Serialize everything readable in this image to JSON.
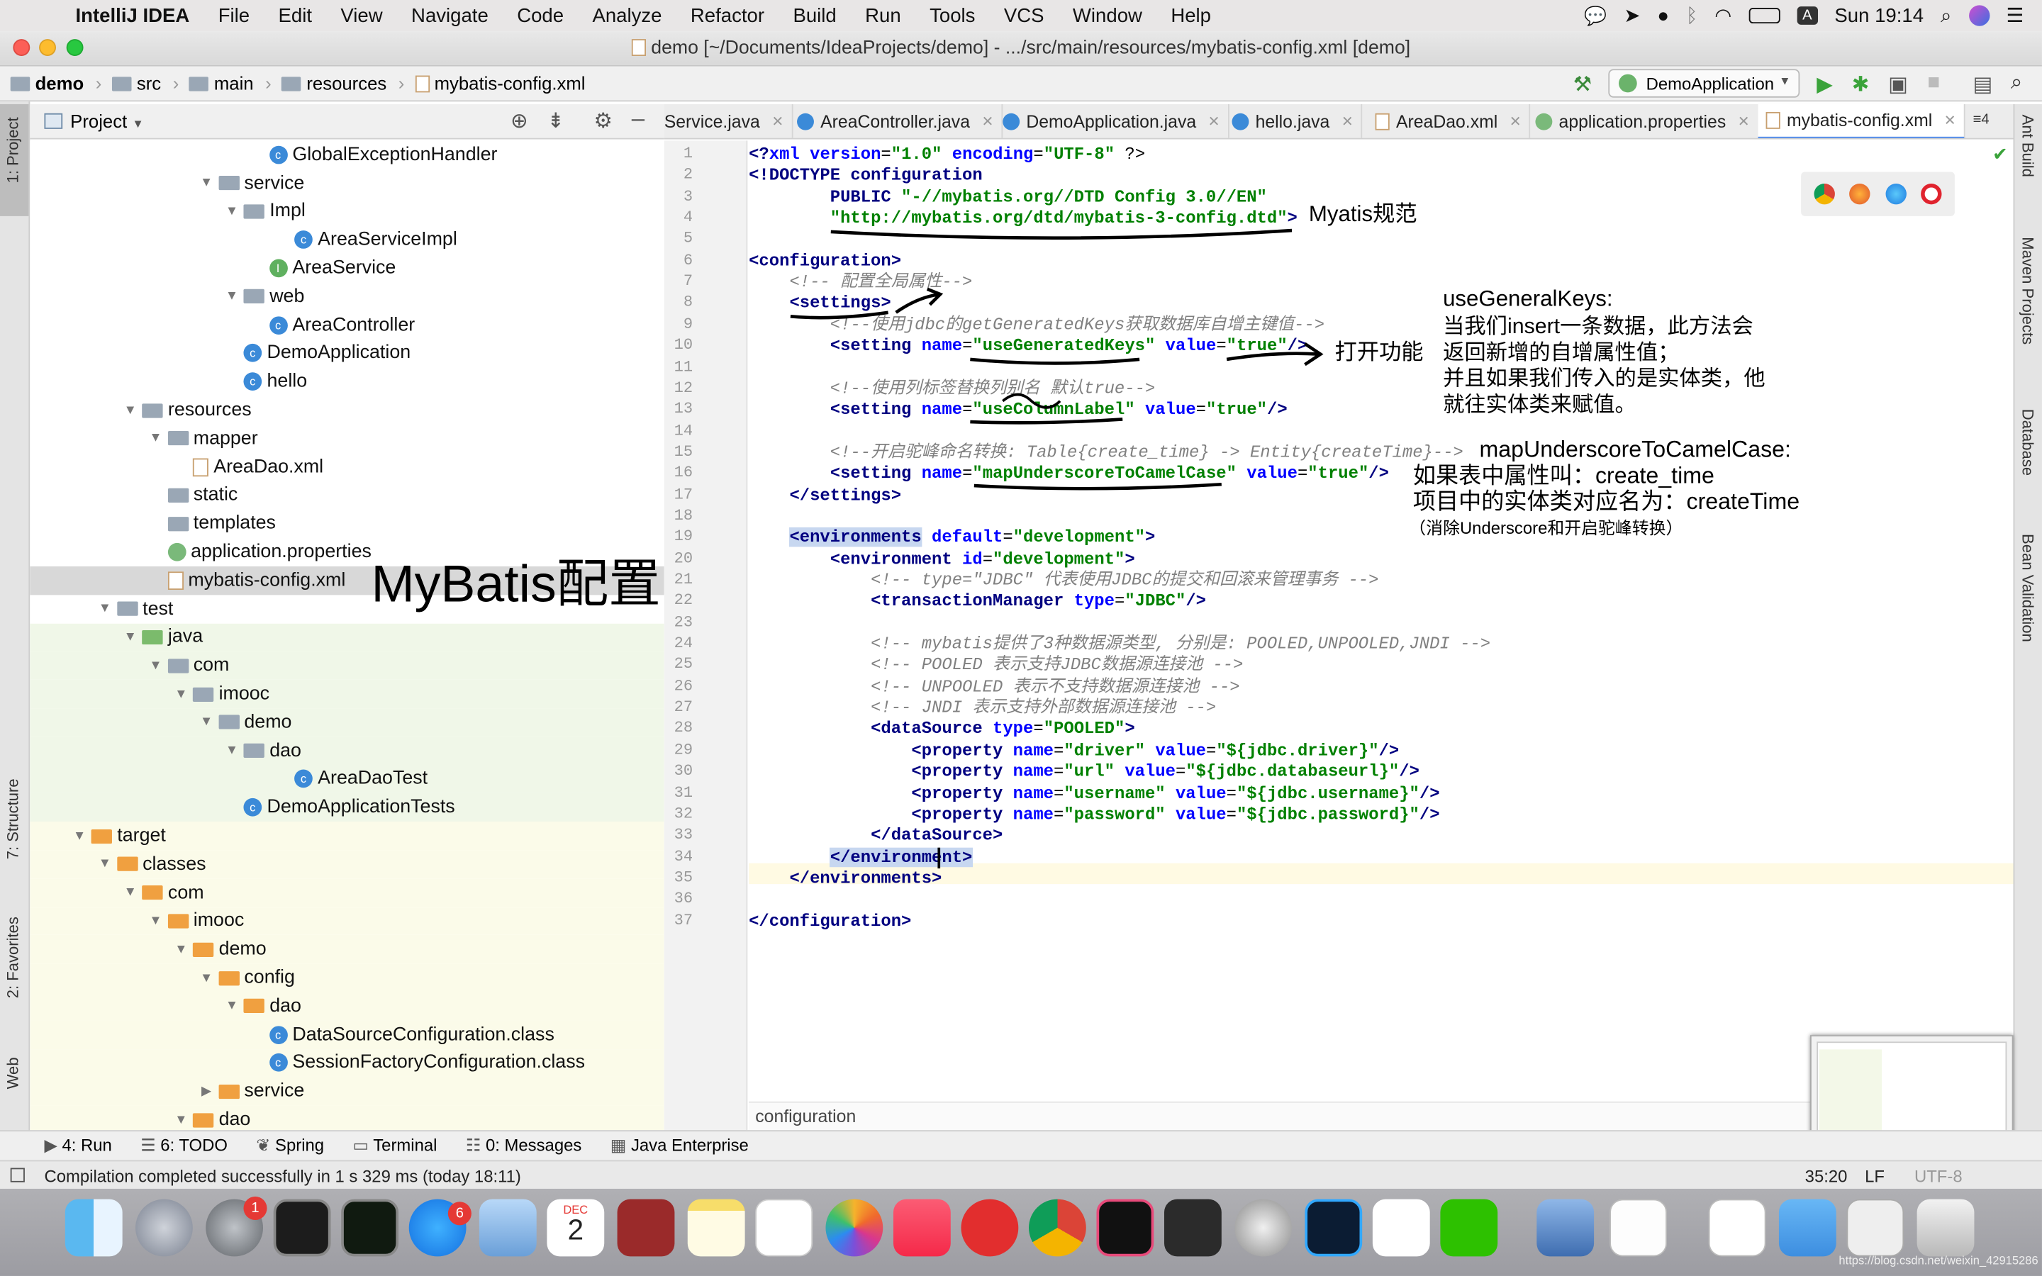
{
  "menubar": {
    "app_name": "IntelliJ IDEA",
    "items": [
      "File",
      "Edit",
      "View",
      "Navigate",
      "Code",
      "Analyze",
      "Refactor",
      "Build",
      "Run",
      "Tools",
      "VCS",
      "Window",
      "Help"
    ],
    "clock": "Sun 19:14",
    "input_indicator": "A"
  },
  "window": {
    "title": "demo [~/Documents/IdeaProjects/demo] - .../src/main/resources/mybatis-config.xml [demo]"
  },
  "breadcrumb": [
    "demo",
    "src",
    "main",
    "resources",
    "mybatis-config.xml"
  ],
  "run_config": "DemoApplication",
  "project_panel": {
    "title": "Project",
    "rows": [
      {
        "label": "GlobalExceptionHandler",
        "icon": "class-icon",
        "depth": 9,
        "arrow": ""
      },
      {
        "label": "service",
        "icon": "folder-icon",
        "depth": 7,
        "arrow": "▼"
      },
      {
        "label": "Impl",
        "icon": "folder-icon",
        "depth": 8,
        "arrow": "▼"
      },
      {
        "label": "AreaServiceImpl",
        "icon": "class-icon",
        "depth": 10,
        "arrow": ""
      },
      {
        "label": "AreaService",
        "icon": "interface-icon",
        "depth": 9,
        "arrow": ""
      },
      {
        "label": "web",
        "icon": "folder-icon",
        "depth": 8,
        "arrow": "▼"
      },
      {
        "label": "AreaController",
        "icon": "class-icon",
        "depth": 9,
        "arrow": ""
      },
      {
        "label": "DemoApplication",
        "icon": "spring-class-icon",
        "depth": 8,
        "arrow": ""
      },
      {
        "label": "hello",
        "icon": "class-icon",
        "depth": 8,
        "arrow": ""
      },
      {
        "label": "resources",
        "icon": "resources-folder-icon",
        "depth": 4,
        "arrow": "▼"
      },
      {
        "label": "mapper",
        "icon": "folder-icon",
        "depth": 5,
        "arrow": "▼"
      },
      {
        "label": "AreaDao.xml",
        "icon": "xml-file-icon",
        "depth": 6,
        "arrow": ""
      },
      {
        "label": "static",
        "icon": "folder-icon",
        "depth": 5,
        "arrow": ""
      },
      {
        "label": "templates",
        "icon": "folder-icon",
        "depth": 5,
        "arrow": ""
      },
      {
        "label": "application.properties",
        "icon": "properties-file-icon",
        "depth": 5,
        "arrow": ""
      },
      {
        "label": "mybatis-config.xml",
        "icon": "xml-file-icon",
        "depth": 5,
        "arrow": "",
        "selected": true
      },
      {
        "label": "test",
        "icon": "folder-icon",
        "depth": 3,
        "arrow": "▼"
      },
      {
        "label": "java",
        "icon": "test-folder-icon",
        "depth": 4,
        "arrow": "▼",
        "bg": "test"
      },
      {
        "label": "com",
        "icon": "folder-icon",
        "depth": 5,
        "arrow": "▼",
        "bg": "test"
      },
      {
        "label": "imooc",
        "icon": "folder-icon",
        "depth": 6,
        "arrow": "▼",
        "bg": "test"
      },
      {
        "label": "demo",
        "icon": "folder-icon",
        "depth": 7,
        "arrow": "▼",
        "bg": "test"
      },
      {
        "label": "dao",
        "icon": "folder-icon",
        "depth": 8,
        "arrow": "▼",
        "bg": "test"
      },
      {
        "label": "AreaDaoTest",
        "icon": "test-class-icon",
        "depth": 10,
        "arrow": "",
        "bg": "test"
      },
      {
        "label": "DemoApplicationTests",
        "icon": "test-class-icon",
        "depth": 8,
        "arrow": "",
        "bg": "test"
      },
      {
        "label": "target",
        "icon": "orange-folder-icon",
        "depth": 2,
        "arrow": "▼",
        "bg": "target"
      },
      {
        "label": "classes",
        "icon": "orange-folder-icon",
        "depth": 3,
        "arrow": "▼",
        "bg": "target"
      },
      {
        "label": "com",
        "icon": "orange-folder-icon",
        "depth": 4,
        "arrow": "▼",
        "bg": "target"
      },
      {
        "label": "imooc",
        "icon": "orange-folder-icon",
        "depth": 5,
        "arrow": "▼",
        "bg": "target"
      },
      {
        "label": "demo",
        "icon": "orange-folder-icon",
        "depth": 6,
        "arrow": "▼",
        "bg": "target"
      },
      {
        "label": "config",
        "icon": "orange-folder-icon",
        "depth": 7,
        "arrow": "▼",
        "bg": "target"
      },
      {
        "label": "dao",
        "icon": "orange-folder-icon",
        "depth": 8,
        "arrow": "▼",
        "bg": "target"
      },
      {
        "label": "DataSourceConfiguration.class",
        "icon": "class-icon",
        "depth": 9,
        "arrow": "",
        "bg": "target"
      },
      {
        "label": "SessionFactoryConfiguration.class",
        "icon": "class-icon",
        "depth": 9,
        "arrow": "",
        "bg": "target"
      },
      {
        "label": "service",
        "icon": "orange-folder-icon",
        "depth": 7,
        "arrow": "▶",
        "bg": "target"
      },
      {
        "label": "dao",
        "icon": "orange-folder-icon",
        "depth": 6,
        "arrow": "▼",
        "bg": "target"
      }
    ]
  },
  "tabs": [
    {
      "label": "Service.java",
      "active": false
    },
    {
      "label": "AreaController.java",
      "active": false
    },
    {
      "label": "DemoApplication.java",
      "active": false
    },
    {
      "label": "hello.java",
      "active": false
    },
    {
      "label": "AreaDao.xml",
      "active": false
    },
    {
      "label": "application.properties",
      "active": false
    },
    {
      "label": "mybatis-config.xml",
      "active": true
    }
  ],
  "tab_overflow": "≡4",
  "left_stripe": [
    "1: Project",
    "7: Structure",
    "2: Favorites",
    "Web"
  ],
  "right_stripe": [
    "Ant Build",
    "Maven Projects",
    "Database",
    "Bean Validation"
  ],
  "editor": {
    "lines": [
      [
        [
          "tag",
          "<?"
        ],
        [
          "attr",
          "xml "
        ],
        [
          "attr",
          "version"
        ],
        [
          "",
          "="
        ],
        [
          "str",
          "\"1.0\""
        ],
        [
          "attr",
          " encoding"
        ],
        [
          "",
          "="
        ],
        [
          "str",
          "\"UTF-8\""
        ],
        [
          "",
          " ?>"
        ]
      ],
      [
        [
          "tag",
          "<!DOCTYPE "
        ],
        [
          "tag",
          "configuration"
        ]
      ],
      [
        [
          "",
          "        "
        ],
        [
          "tag",
          "PUBLIC "
        ],
        [
          "str",
          "\"-//mybatis.org//DTD Config 3.0//EN\""
        ]
      ],
      [
        [
          "",
          "        "
        ],
        [
          "str",
          "\"http://mybatis.org/dtd/mybatis-3-config.dtd\""
        ],
        [
          "tag",
          ">"
        ]
      ],
      [
        [
          "",
          ""
        ]
      ],
      [
        [
          "tag",
          "<configuration>"
        ]
      ],
      [
        [
          "",
          "    "
        ],
        [
          "cmt",
          "<!-- 配置全局属性-->"
        ]
      ],
      [
        [
          "",
          "    "
        ],
        [
          "tag",
          "<settings>"
        ]
      ],
      [
        [
          "",
          "        "
        ],
        [
          "cmt",
          "<!--使用jdbc的getGeneratedKeys获取数据库自增主键值-->"
        ]
      ],
      [
        [
          "",
          "        "
        ],
        [
          "tag",
          "<setting "
        ],
        [
          "attr",
          "name"
        ],
        [
          "",
          "="
        ],
        [
          "str",
          "\"useGeneratedKeys\""
        ],
        [
          "attr",
          " value"
        ],
        [
          "",
          "="
        ],
        [
          "str",
          "\"true\""
        ],
        [
          "tag",
          "/>"
        ]
      ],
      [
        [
          "",
          ""
        ]
      ],
      [
        [
          "",
          "        "
        ],
        [
          "cmt",
          "<!--使用列标签替换列别名 默认true-->"
        ]
      ],
      [
        [
          "",
          "        "
        ],
        [
          "tag",
          "<setting "
        ],
        [
          "attr",
          "name"
        ],
        [
          "",
          "="
        ],
        [
          "str",
          "\"useColumnLabel\""
        ],
        [
          "attr",
          " value"
        ],
        [
          "",
          "="
        ],
        [
          "str",
          "\"true\""
        ],
        [
          "tag",
          "/>"
        ]
      ],
      [
        [
          "",
          ""
        ]
      ],
      [
        [
          "",
          "        "
        ],
        [
          "cmt",
          "<!--开启驼峰命名转换: Table{create_time} -> Entity{createTime}-->"
        ]
      ],
      [
        [
          "",
          "        "
        ],
        [
          "tag",
          "<setting "
        ],
        [
          "attr",
          "name"
        ],
        [
          "",
          "="
        ],
        [
          "str",
          "\"mapUnderscoreToCamelCase\""
        ],
        [
          "attr",
          " value"
        ],
        [
          "",
          "="
        ],
        [
          "str",
          "\"true\""
        ],
        [
          "tag",
          "/>"
        ]
      ],
      [
        [
          "",
          "    "
        ],
        [
          "tag",
          "</settings>"
        ]
      ],
      [
        [
          "",
          ""
        ]
      ],
      [
        [
          "",
          "    "
        ],
        [
          "tag",
          "<environments"
        ],
        [
          "attr",
          " default"
        ],
        [
          "",
          "="
        ],
        [
          "str",
          "\"development\""
        ],
        [
          "tag",
          ">"
        ]
      ],
      [
        [
          "",
          "        "
        ],
        [
          "tag",
          "<environment "
        ],
        [
          "attr",
          "id"
        ],
        [
          "",
          "="
        ],
        [
          "str",
          "\"development\""
        ],
        [
          "tag",
          ">"
        ]
      ],
      [
        [
          "",
          "            "
        ],
        [
          "cmt",
          "<!-- type=\"JDBC\" 代表使用JDBC的提交和回滚来管理事务 -->"
        ]
      ],
      [
        [
          "",
          "            "
        ],
        [
          "tag",
          "<transactionManager "
        ],
        [
          "attr",
          "type"
        ],
        [
          "",
          "="
        ],
        [
          "str",
          "\"JDBC\""
        ],
        [
          "tag",
          "/>"
        ]
      ],
      [
        [
          "",
          ""
        ]
      ],
      [
        [
          "",
          "            "
        ],
        [
          "cmt",
          "<!-- mybatis提供了3种数据源类型, 分别是: POOLED,UNPOOLED,JNDI -->"
        ]
      ],
      [
        [
          "",
          "            "
        ],
        [
          "cmt",
          "<!-- POOLED 表示支持JDBC数据源连接池 -->"
        ]
      ],
      [
        [
          "",
          "            "
        ],
        [
          "cmt",
          "<!-- UNPOOLED 表示不支持数据源连接池 -->"
        ]
      ],
      [
        [
          "",
          "            "
        ],
        [
          "cmt",
          "<!-- JNDI 表示支持外部数据源连接池 -->"
        ]
      ],
      [
        [
          "",
          "            "
        ],
        [
          "tag",
          "<dataSource "
        ],
        [
          "attr",
          "type"
        ],
        [
          "",
          "="
        ],
        [
          "str",
          "\"POOLED\""
        ],
        [
          "tag",
          ">"
        ]
      ],
      [
        [
          "",
          "                "
        ],
        [
          "tag",
          "<property "
        ],
        [
          "attr",
          "name"
        ],
        [
          "",
          "="
        ],
        [
          "str",
          "\"driver\""
        ],
        [
          "attr",
          " value"
        ],
        [
          "",
          "="
        ],
        [
          "str",
          "\"${jdbc.driver}\""
        ],
        [
          "tag",
          "/>"
        ]
      ],
      [
        [
          "",
          "                "
        ],
        [
          "tag",
          "<property "
        ],
        [
          "attr",
          "name"
        ],
        [
          "",
          "="
        ],
        [
          "str",
          "\"url\""
        ],
        [
          "attr",
          " value"
        ],
        [
          "",
          "="
        ],
        [
          "str",
          "\"${jdbc.databaseurl}\""
        ],
        [
          "tag",
          "/>"
        ]
      ],
      [
        [
          "",
          "                "
        ],
        [
          "tag",
          "<property "
        ],
        [
          "attr",
          "name"
        ],
        [
          "",
          "="
        ],
        [
          "str",
          "\"username\""
        ],
        [
          "attr",
          " value"
        ],
        [
          "",
          "="
        ],
        [
          "str",
          "\"${jdbc.username}\""
        ],
        [
          "tag",
          "/>"
        ]
      ],
      [
        [
          "",
          "                "
        ],
        [
          "tag",
          "<property "
        ],
        [
          "attr",
          "name"
        ],
        [
          "",
          "="
        ],
        [
          "str",
          "\"password\""
        ],
        [
          "attr",
          " value"
        ],
        [
          "",
          "="
        ],
        [
          "str",
          "\"${jdbc.password}\""
        ],
        [
          "tag",
          "/>"
        ]
      ],
      [
        [
          "",
          "            "
        ],
        [
          "tag",
          "</dataSource>"
        ]
      ],
      [
        [
          "",
          "        "
        ],
        [
          "tag",
          "</environment>"
        ]
      ],
      [
        [
          "",
          "    "
        ],
        [
          "tag",
          "</environments>"
        ]
      ],
      [
        [
          "",
          ""
        ]
      ],
      [
        [
          "tag",
          "</configuration>"
        ]
      ]
    ],
    "crumb": "configuration"
  },
  "annotations": {
    "dtd_note": "Myatis规范",
    "enable_note": "打开功能",
    "mybatis_title": "MyBatis配置",
    "keys_title": "useGeneralKeys:",
    "keys_lines": [
      "当我们insert一条数据，此方法会",
      "返回新增的自增属性值；",
      "并且如果我们传入的是实体类，他",
      "就往实体类来赋值。"
    ],
    "camel_title": "mapUnderscoreToCamelCase:",
    "camel_lines": [
      "如果表中属性叫：create_time",
      "项目中的实体类对应名为：createTime"
    ],
    "camel_small": "（消除Underscore和开启驼峰转换）"
  },
  "bottom_tools": [
    "4: Run",
    "6: TODO",
    "Spring",
    "Terminal",
    "0: Messages",
    "Java Enterprise"
  ],
  "status": {
    "message": "Compilation completed successfully in 1 s 329 ms (today 18:11)",
    "position": "35:20",
    "line_sep": "LF",
    "encoding": "UTF-8"
  },
  "dock": {
    "badge_prefs": "1",
    "badge_appstore": "6",
    "calendar_month": "DEC",
    "calendar_day": "2"
  },
  "watermark": "https://blog.csdn.net/weixin_42915286"
}
